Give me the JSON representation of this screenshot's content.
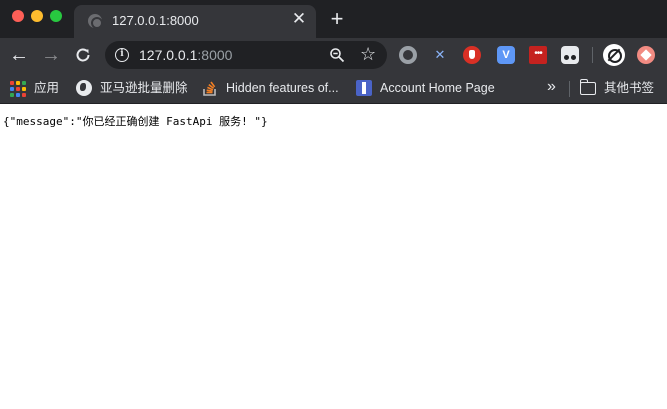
{
  "window": {
    "tab_title": "127.0.0.1:8000",
    "tab_close_glyph": "✕",
    "new_tab_glyph": "+"
  },
  "toolbar": {
    "back_glyph": "←",
    "forward_glyph": "→",
    "url_host": "127.0.0.1",
    "url_port": ":8000",
    "info_glyph": "i",
    "star_glyph": "☆",
    "extensions": [
      {
        "icon": "circle-extension-icon"
      },
      {
        "icon": "x-extension-icon",
        "glyph": "✕"
      },
      {
        "icon": "hand-extension-icon"
      },
      {
        "icon": "v-extension-icon",
        "glyph": "V"
      },
      {
        "icon": "dots-extension-icon",
        "glyph": "•••"
      },
      {
        "icon": "oo-extension-icon"
      },
      {
        "icon": "no-track-extension-icon"
      },
      {
        "icon": "diamond-extension-icon"
      }
    ]
  },
  "bookmarks": {
    "items": [
      {
        "label": "应用",
        "icon": "apps-grid-icon"
      },
      {
        "label": "亚马逊批量删除",
        "icon": "globe-icon"
      },
      {
        "label": "Hidden features of...",
        "icon": "stackoverflow-icon"
      },
      {
        "label": "Account Home Page",
        "icon": "account-icon"
      }
    ],
    "more_glyph": "»",
    "other_bookmarks": "其他书签"
  },
  "page": {
    "body_text": "{\"message\":\"你已经正确创建 FastApi 服务! \"}"
  },
  "colors": {
    "titlebar": "#202124",
    "toolbar": "#35363a",
    "text_light": "#e8eaed",
    "page_bg": "#ffffff"
  }
}
